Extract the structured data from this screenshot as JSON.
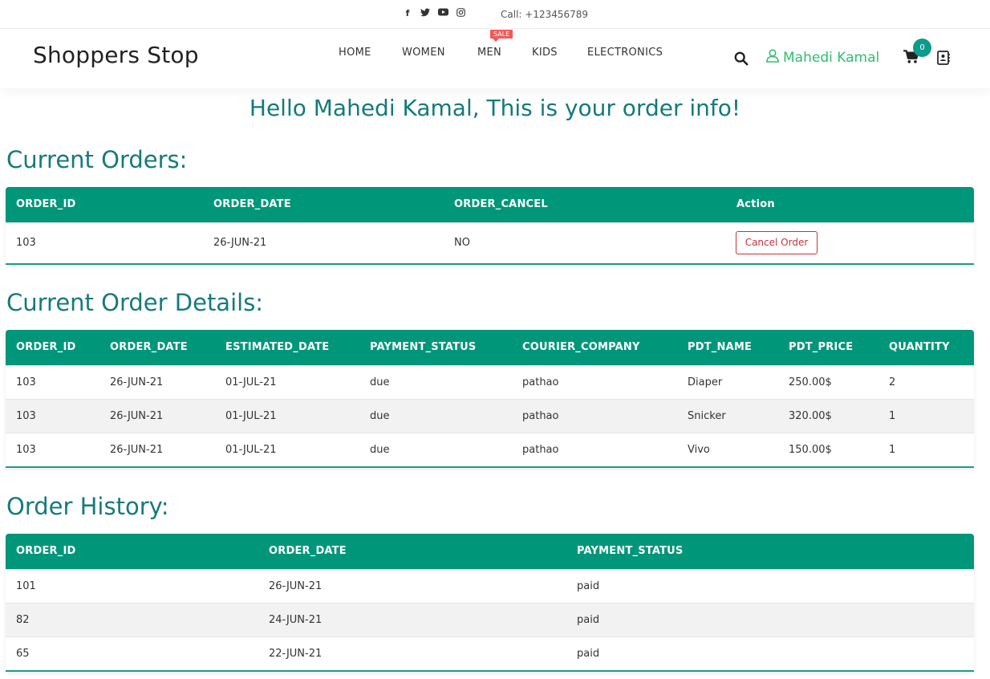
{
  "topbar": {
    "social": [
      {
        "icon": "facebook-icon",
        "glyph": "f"
      },
      {
        "icon": "twitter-icon",
        "glyph": "🐦"
      },
      {
        "icon": "youtube-icon",
        "glyph": "▶"
      },
      {
        "icon": "instagram-icon",
        "glyph": "◎"
      }
    ],
    "call": "Call: +123456789"
  },
  "header": {
    "brand": "Shoppers Stop",
    "nav": [
      "HOME",
      "WOMEN",
      "MEN",
      "KIDS",
      "ELECTRONICS"
    ],
    "sale_badge": "SALE",
    "user_name": "Mahedi Kamal",
    "cart_count": "0"
  },
  "greeting": "Hello Mahedi Kamal, This is your order info!",
  "current_orders": {
    "title": "Current Orders:",
    "columns": [
      "ORDER_ID",
      "ORDER_DATE",
      "ORDER_CANCEL",
      "Action"
    ],
    "rows": [
      {
        "order_id": "103",
        "order_date": "26-JUN-21",
        "order_cancel": "NO",
        "action": "Cancel Order"
      }
    ]
  },
  "order_details": {
    "title": "Current Order Details:",
    "columns": [
      "ORDER_ID",
      "ORDER_DATE",
      "ESTIMATED_DATE",
      "PAYMENT_STATUS",
      "COURIER_COMPANY",
      "PDT_NAME",
      "PDT_PRICE",
      "QUANTITY"
    ],
    "rows": [
      [
        "103",
        "26-JUN-21",
        "01-JUL-21",
        "due",
        "pathao",
        "Diaper",
        "250.00$",
        "2"
      ],
      [
        "103",
        "26-JUN-21",
        "01-JUL-21",
        "due",
        "pathao",
        "Snicker",
        "320.00$",
        "1"
      ],
      [
        "103",
        "26-JUN-21",
        "01-JUL-21",
        "due",
        "pathao",
        "Vivo",
        "150.00$",
        "1"
      ]
    ]
  },
  "order_history": {
    "title": "Order History:",
    "columns": [
      "ORDER_ID",
      "ORDER_DATE",
      "PAYMENT_STATUS"
    ],
    "rows": [
      [
        "101",
        "26-JUN-21",
        "paid"
      ],
      [
        "82",
        "24-JUN-21",
        "paid"
      ],
      [
        "65",
        "22-JUN-21",
        "paid"
      ]
    ]
  },
  "colors": {
    "accent_green": "#00967a",
    "title_teal": "#147a7b",
    "user_green": "#2fbf71",
    "sale_red": "#f15a5a",
    "cancel_red": "#c4343b"
  }
}
